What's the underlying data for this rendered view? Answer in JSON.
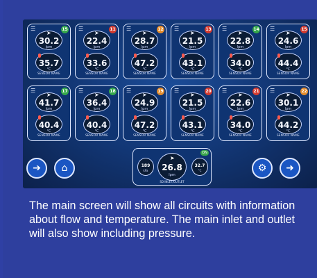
{
  "circuits": [
    {
      "flow": "30.2",
      "temp": "35.7",
      "status_color": "#35a84a",
      "status_text": "15"
    },
    {
      "flow": "22.4",
      "temp": "33.6",
      "status_color": "#d33a2f",
      "status_text": "11"
    },
    {
      "flow": "28.7",
      "temp": "47.2",
      "status_color": "#e48b2a",
      "status_text": "12"
    },
    {
      "flow": "21.5",
      "temp": "43.1",
      "status_color": "#d33a2f",
      "status_text": "13"
    },
    {
      "flow": "22.8",
      "temp": "34.0",
      "status_color": "#35a84a",
      "status_text": "14"
    },
    {
      "flow": "24.6",
      "temp": "44.4",
      "status_color": "#d33a2f",
      "status_text": "15"
    },
    {
      "flow": "41.7",
      "temp": "40.4",
      "status_color": "#35a84a",
      "status_text": "17"
    },
    {
      "flow": "36.4",
      "temp": "40.4",
      "status_color": "#35a84a",
      "status_text": "18"
    },
    {
      "flow": "24.9",
      "temp": "47.2",
      "status_color": "#e48b2a",
      "status_text": "19"
    },
    {
      "flow": "21.5",
      "temp": "43.1",
      "status_color": "#d33a2f",
      "status_text": "20"
    },
    {
      "flow": "22.6",
      "temp": "34.0",
      "status_color": "#d33a2f",
      "status_text": "21"
    },
    {
      "flow": "30.1",
      "temp": "44.2",
      "status_color": "#e48b2a",
      "status_text": "22"
    }
  ],
  "circuit_label": "SENSOR NAME",
  "flow_unit": "lpm",
  "temp_unit": "°C",
  "inlet": {
    "left_value": "189",
    "left_unit": "kPa",
    "center_value": "26.8",
    "center_unit": "lpm",
    "right_value": "32.7",
    "right_unit": "°C",
    "status_text": "ON",
    "label": "SD INLET/OUTLET"
  },
  "caption": "The main screen will show all circuits with information about flow and temperature. The main inlet and outlet will also show including pressure."
}
